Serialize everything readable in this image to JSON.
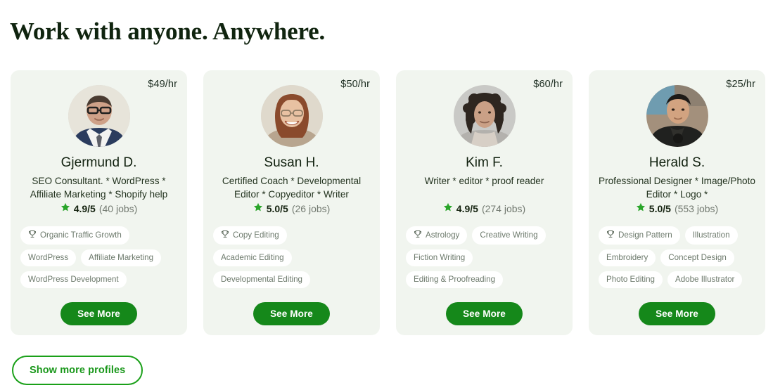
{
  "headline": "Work with anyone. Anywhere.",
  "show_more_label": "Show more profiles",
  "colors": {
    "card_bg": "#f1f5ef",
    "primary_green": "#15881a",
    "outline_green": "#1aa019",
    "star_green": "#2aa52a",
    "tag_text": "#6d7a6c",
    "heading": "#10240f"
  },
  "profiles": [
    {
      "name": "Gjermund D.",
      "price": "$49/hr",
      "description": "SEO Consultant. * WordPress * Affiliate Marketing * Shopify help",
      "rating": "4.9/5",
      "jobs": "(40 jobs)",
      "avatar_alt": "avatar-gjermund-d",
      "tags": [
        "Organic Traffic Growth",
        "WordPress",
        "Affiliate Marketing",
        "WordPress Development"
      ],
      "see_more_label": "See More"
    },
    {
      "name": "Susan H.",
      "price": "$50/hr",
      "description": "Certified Coach * Developmental Editor * Copyeditor * Writer",
      "rating": "5.0/5",
      "jobs": "(26 jobs)",
      "avatar_alt": "avatar-susan-h",
      "tags": [
        "Copy Editing",
        "Academic Editing",
        "Developmental Editing"
      ],
      "see_more_label": "See More"
    },
    {
      "name": "Kim F.",
      "price": "$60/hr",
      "description": "Writer * editor * proof reader",
      "rating": "4.9/5",
      "jobs": "(274 jobs)",
      "avatar_alt": "avatar-kim-f",
      "tags": [
        "Astrology",
        "Creative Writing",
        "Fiction Writing",
        "Editing & Proofreading"
      ],
      "see_more_label": "See More"
    },
    {
      "name": "Herald S.",
      "price": "$25/hr",
      "description": "Professional Designer * Image/Photo Editor * Logo *",
      "rating": "5.0/5",
      "jobs": "(553 jobs)",
      "avatar_alt": "avatar-herald-s",
      "tags": [
        "Design Pattern",
        "Illustration",
        "Embroidery",
        "Concept Design",
        "Photo Editing",
        "Adobe Illustrator"
      ],
      "see_more_label": "See More"
    }
  ]
}
